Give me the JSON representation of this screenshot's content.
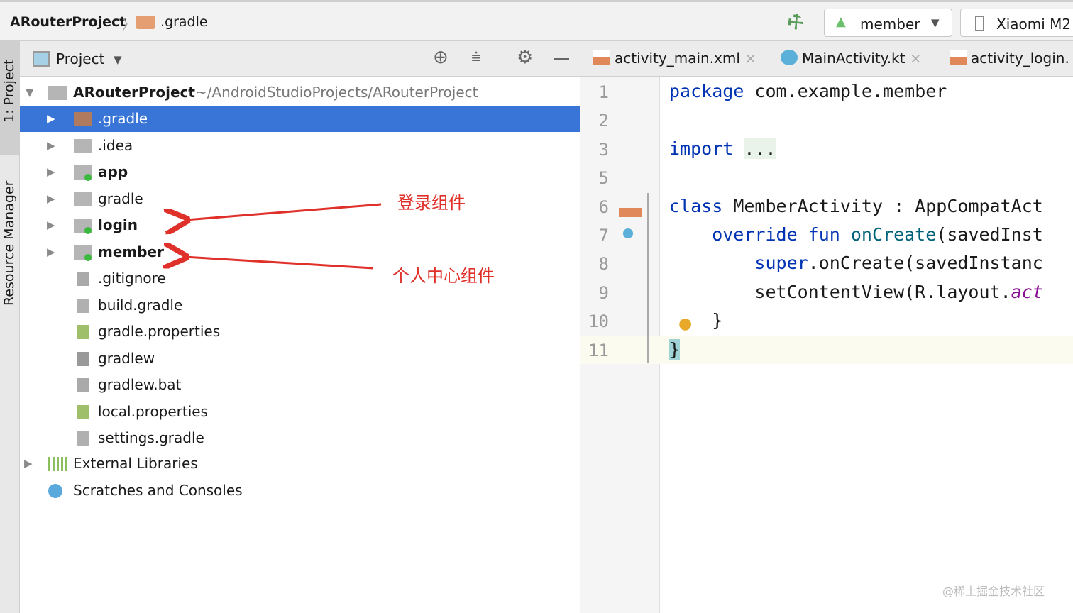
{
  "breadcrumb": {
    "project": "ARouterProject",
    "folder": ".gradle"
  },
  "toolbar": {
    "config": "member",
    "device": "Xiaomi M2"
  },
  "side": {
    "project_tab": "1: Project",
    "resource_tab": "Resource Manager"
  },
  "panel": {
    "title": "Project"
  },
  "tree": {
    "root": {
      "name": "ARouterProject",
      "path": "~/AndroidStudioProjects/ARouterProject"
    },
    "items": [
      {
        "label": ".gradle",
        "kind": "folder-brown",
        "expandable": true,
        "bold": false,
        "selected": true
      },
      {
        "label": ".idea",
        "kind": "folder",
        "expandable": true
      },
      {
        "label": "app",
        "kind": "module",
        "expandable": true,
        "bold": true
      },
      {
        "label": "gradle",
        "kind": "folder",
        "expandable": true
      },
      {
        "label": "login",
        "kind": "module",
        "expandable": true,
        "bold": true
      },
      {
        "label": "member",
        "kind": "module",
        "expandable": true,
        "bold": true
      },
      {
        "label": ".gitignore",
        "kind": "file"
      },
      {
        "label": "build.gradle",
        "kind": "gradle"
      },
      {
        "label": "gradle.properties",
        "kind": "props"
      },
      {
        "label": "gradlew",
        "kind": "exec"
      },
      {
        "label": "gradlew.bat",
        "kind": "file"
      },
      {
        "label": "local.properties",
        "kind": "props"
      },
      {
        "label": "settings.gradle",
        "kind": "gradle"
      }
    ],
    "external": "External Libraries",
    "scratches": "Scratches and Consoles"
  },
  "annotations": {
    "login": "登录组件",
    "member": "个人中心组件"
  },
  "tabs": [
    {
      "label": "activity_main.xml",
      "icon": "xml"
    },
    {
      "label": "MainActivity.kt",
      "icon": "kotlin"
    },
    {
      "label": "activity_login.",
      "icon": "xml"
    }
  ],
  "editor": {
    "lines": [
      {
        "n": "1",
        "tokens": [
          {
            "t": "package ",
            "c": "k"
          },
          {
            "t": "com.example.member",
            "c": ""
          }
        ]
      },
      {
        "n": "2",
        "tokens": []
      },
      {
        "n": "3",
        "tokens": [
          {
            "t": "import ",
            "c": "k"
          },
          {
            "t": "...",
            "c": "fold"
          }
        ]
      },
      {
        "n": "5",
        "tokens": []
      },
      {
        "n": "6",
        "tokens": [
          {
            "t": "class ",
            "c": "k"
          },
          {
            "t": "MemberActivity : AppCompatAct",
            "c": ""
          }
        ]
      },
      {
        "n": "7",
        "tokens": [
          {
            "t": "    override fun ",
            "c": "k"
          },
          {
            "t": "onCreate",
            "c": "f"
          },
          {
            "t": "(savedInst",
            "c": ""
          }
        ]
      },
      {
        "n": "8",
        "tokens": [
          {
            "t": "        super",
            "c": "k"
          },
          {
            "t": ".onCreate(savedInstanc",
            "c": ""
          }
        ]
      },
      {
        "n": "9",
        "tokens": [
          {
            "t": "        setContentView(R.layout.",
            "c": ""
          },
          {
            "t": "act",
            "c": "p"
          }
        ]
      },
      {
        "n": "10",
        "tokens": [
          {
            "t": "    }",
            "c": ""
          }
        ]
      },
      {
        "n": "11",
        "tokens": [
          {
            "t": "}",
            "c": "brace"
          }
        ]
      }
    ]
  },
  "watermark": "@稀土掘金技术社区"
}
